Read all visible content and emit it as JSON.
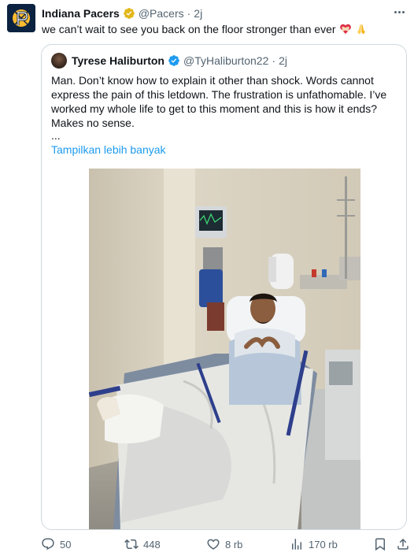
{
  "tweet": {
    "display_name": "Indiana Pacers",
    "handle": "@Pacers",
    "separator": "·",
    "time": "2j",
    "text": "we can’t wait to see you back on the floor stronger than ever",
    "emojis": [
      "heart-bandage-icon",
      "folded-hands-icon"
    ]
  },
  "quote": {
    "display_name": "Tyrese Haliburton",
    "handle": "@TyHaliburton22",
    "separator": "·",
    "time": "2j",
    "lines": [
      "Man. Don’t know how to explain it other than shock. Words cannot",
      "express the pain of this letdown. The frustration is unfathomable. I’ve",
      "worked my whole life to get to this moment and this is how it ends?",
      "Makes no sense."
    ],
    "ellipsis": "...",
    "show_more": "Tampilkan lebih banyak"
  },
  "actions": {
    "replies": "50",
    "reposts": "448",
    "likes": "8 rb",
    "views": "170 rb"
  },
  "colors": {
    "text": "#0f1419",
    "secondary": "#536471",
    "link": "#1d9bf0",
    "gold_badge": "#e2b719",
    "border": "#cfd9de"
  }
}
